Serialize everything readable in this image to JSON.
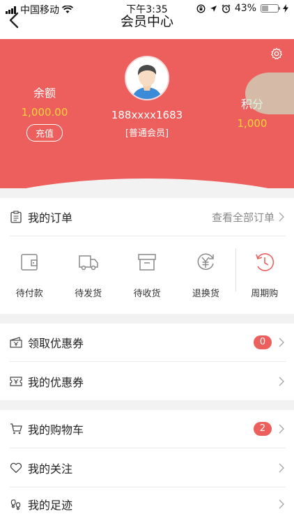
{
  "status_bar": {
    "carrier": "中国移动",
    "time": "下午3:35",
    "battery": "43%",
    "battery_level": 0.43
  },
  "nav": {
    "title": "会员中心"
  },
  "profile": {
    "balance_label": "余额",
    "balance_value": "1,000.00",
    "recharge_label": "充值",
    "phone": "188xxxx1683",
    "level": "[普通会员]",
    "points_label": "积分",
    "points_value": "1,000"
  },
  "orders": {
    "title": "我的订单",
    "view_all": "查看全部订单",
    "items": [
      {
        "label": "待付款",
        "icon": "wallet-icon"
      },
      {
        "label": "待发货",
        "icon": "truck-icon"
      },
      {
        "label": "待收货",
        "icon": "box-icon"
      },
      {
        "label": "退换货",
        "icon": "yuan-return-icon"
      },
      {
        "label": "周期购",
        "icon": "clock-refresh-icon"
      }
    ]
  },
  "coupons": {
    "get_label": "领取优惠券",
    "get_badge": "0",
    "my_label": "我的优惠券"
  },
  "misc": {
    "cart_label": "我的购物车",
    "cart_badge": "2",
    "follow_label": "我的关注",
    "footprint_label": "我的足迹"
  },
  "colors": {
    "brand": "#ec5f5c",
    "highlight": "#ffd53b"
  }
}
